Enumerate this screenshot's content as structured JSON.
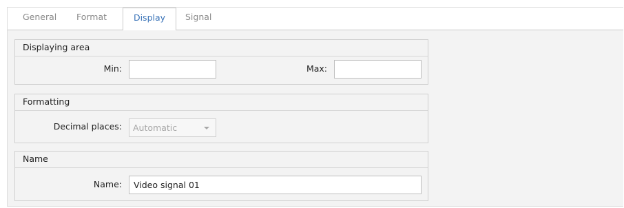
{
  "tabs": [
    {
      "label": "General",
      "active": false
    },
    {
      "label": "Format",
      "active": false
    },
    {
      "label": "Display",
      "active": true
    },
    {
      "label": "Signal",
      "active": false
    }
  ],
  "displaying_area": {
    "title": "Displaying area",
    "min_label": "Min:",
    "min_value": "",
    "max_label": "Max:",
    "max_value": ""
  },
  "formatting": {
    "title": "Formatting",
    "decimal_label": "Decimal places:",
    "decimal_value": "Automatic"
  },
  "name_group": {
    "title": "Name",
    "name_label": "Name:",
    "name_value": "Video signal 01"
  },
  "colors": {
    "active_tab": "#3a73b8",
    "panel_bg": "#f3f3f3",
    "border": "#cfcfcf"
  },
  "icons": {
    "combo_arrow": "chevron-down-icon"
  }
}
